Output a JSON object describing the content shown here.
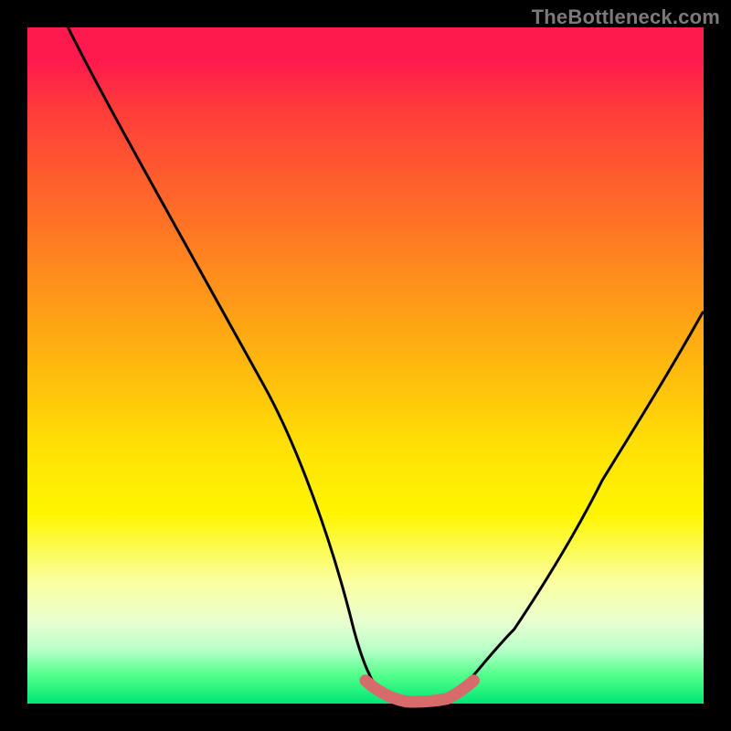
{
  "watermark": "TheBottleneck.com",
  "colors": {
    "frame": "#000000",
    "curve": "#000000",
    "marker": "#d76a6a",
    "gradient_top": "#ff1a4d",
    "gradient_bottom": "#00e676"
  },
  "chart_data": {
    "type": "line",
    "title": "",
    "xlabel": "",
    "ylabel": "",
    "xlim": [
      0,
      100
    ],
    "ylim": [
      0,
      100
    ],
    "series": [
      {
        "name": "bottleneck-curve",
        "x": [
          6,
          10,
          15,
          20,
          25,
          30,
          35,
          40,
          45,
          48,
          50,
          52,
          55,
          58,
          61,
          64,
          67,
          72,
          78,
          85,
          92,
          100
        ],
        "y": [
          100,
          92,
          83,
          74,
          65,
          56,
          47,
          38,
          24,
          12,
          4,
          1,
          0,
          0,
          0,
          1,
          4,
          11,
          21,
          33,
          45,
          58
        ]
      },
      {
        "name": "optimal-marker",
        "x": [
          50,
          52,
          54,
          56,
          58,
          60,
          62,
          64,
          66
        ],
        "y": [
          3.4,
          1.6,
          0.7,
          0.3,
          0.2,
          0.3,
          0.7,
          1.6,
          3.4
        ]
      }
    ],
    "annotations": []
  }
}
